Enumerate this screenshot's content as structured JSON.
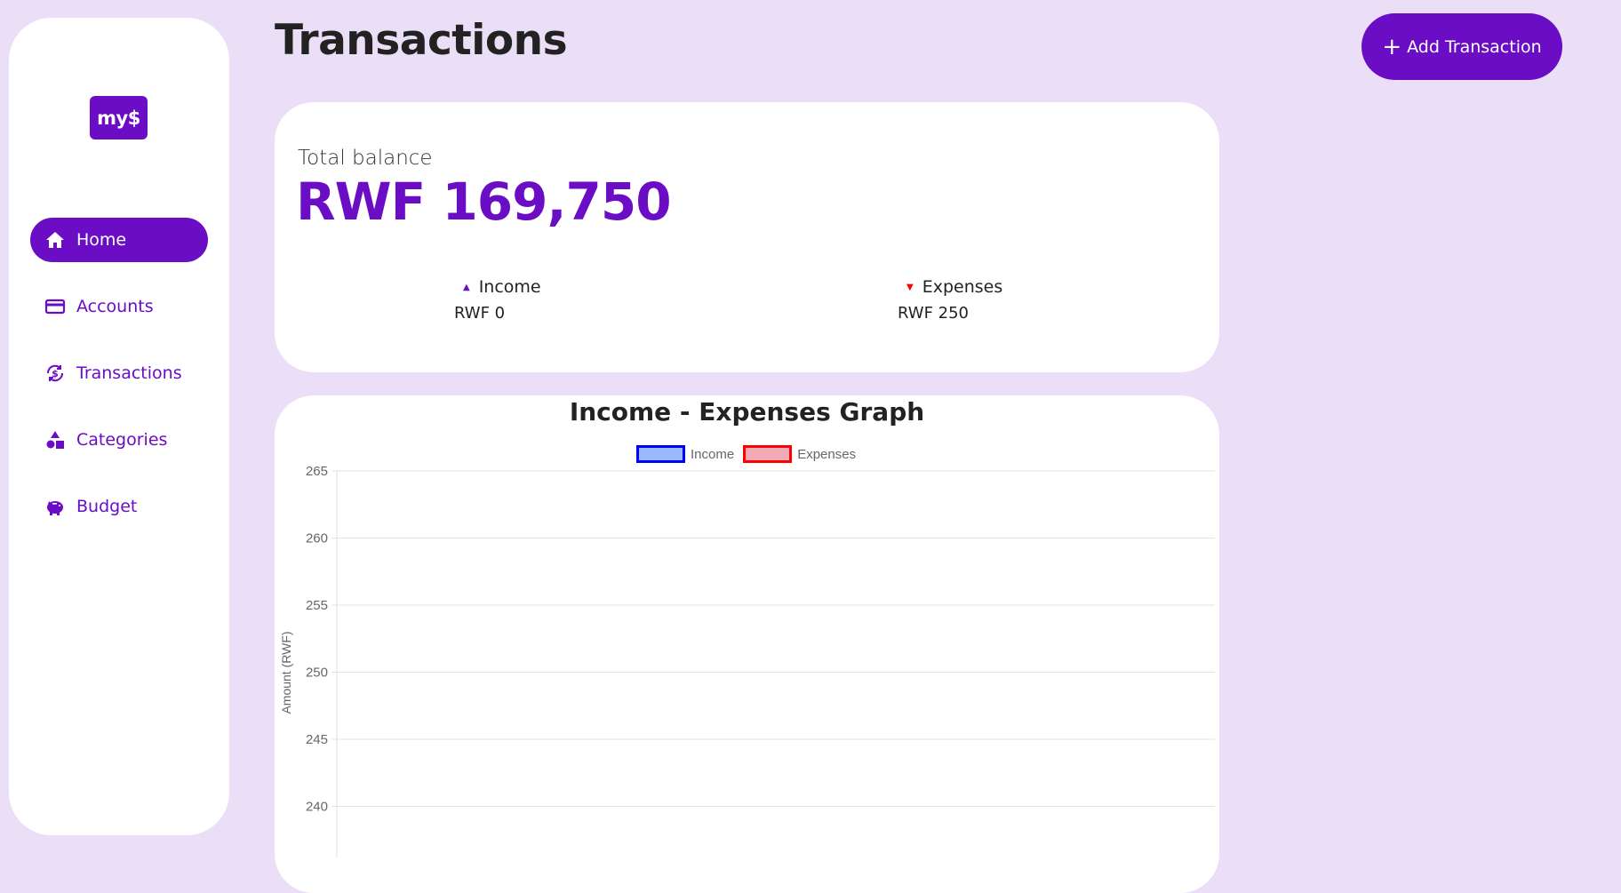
{
  "logo": {
    "text": "my$"
  },
  "sidebar": {
    "items": [
      {
        "label": "Home",
        "icon": "home-icon",
        "active": true
      },
      {
        "label": "Accounts",
        "icon": "credit-card-icon",
        "active": false
      },
      {
        "label": "Transactions",
        "icon": "dollar-cycle-icon",
        "active": false
      },
      {
        "label": "Categories",
        "icon": "shapes-icon",
        "active": false
      },
      {
        "label": "Budget",
        "icon": "piggy-bank-icon",
        "active": false
      }
    ]
  },
  "header": {
    "title": "Transactions",
    "add_button_label": "Add Transaction"
  },
  "balance": {
    "label": "Total balance",
    "value": "RWF 169,750",
    "income_label": "Income",
    "income_value": "RWF 0",
    "expenses_label": "Expenses",
    "expenses_value": "RWF 250"
  },
  "colors": {
    "accent": "#6a0dc4",
    "background": "#ebdff7",
    "income_border": "#0000ff",
    "income_fill": "#9ab8ff",
    "expenses_border": "#ff0000",
    "expenses_fill": "#f4a9b6"
  },
  "chart_data": {
    "type": "bar",
    "title": "Income - Expenses Graph",
    "ylabel": "Amount (RWF)",
    "xlabel": "",
    "legend_position": "top",
    "series": [
      {
        "name": "Income",
        "values": []
      },
      {
        "name": "Expenses",
        "values": []
      }
    ],
    "yticks": [
      265,
      260,
      255,
      250,
      245,
      240
    ],
    "ylim": [
      240,
      265
    ],
    "grid": true
  }
}
